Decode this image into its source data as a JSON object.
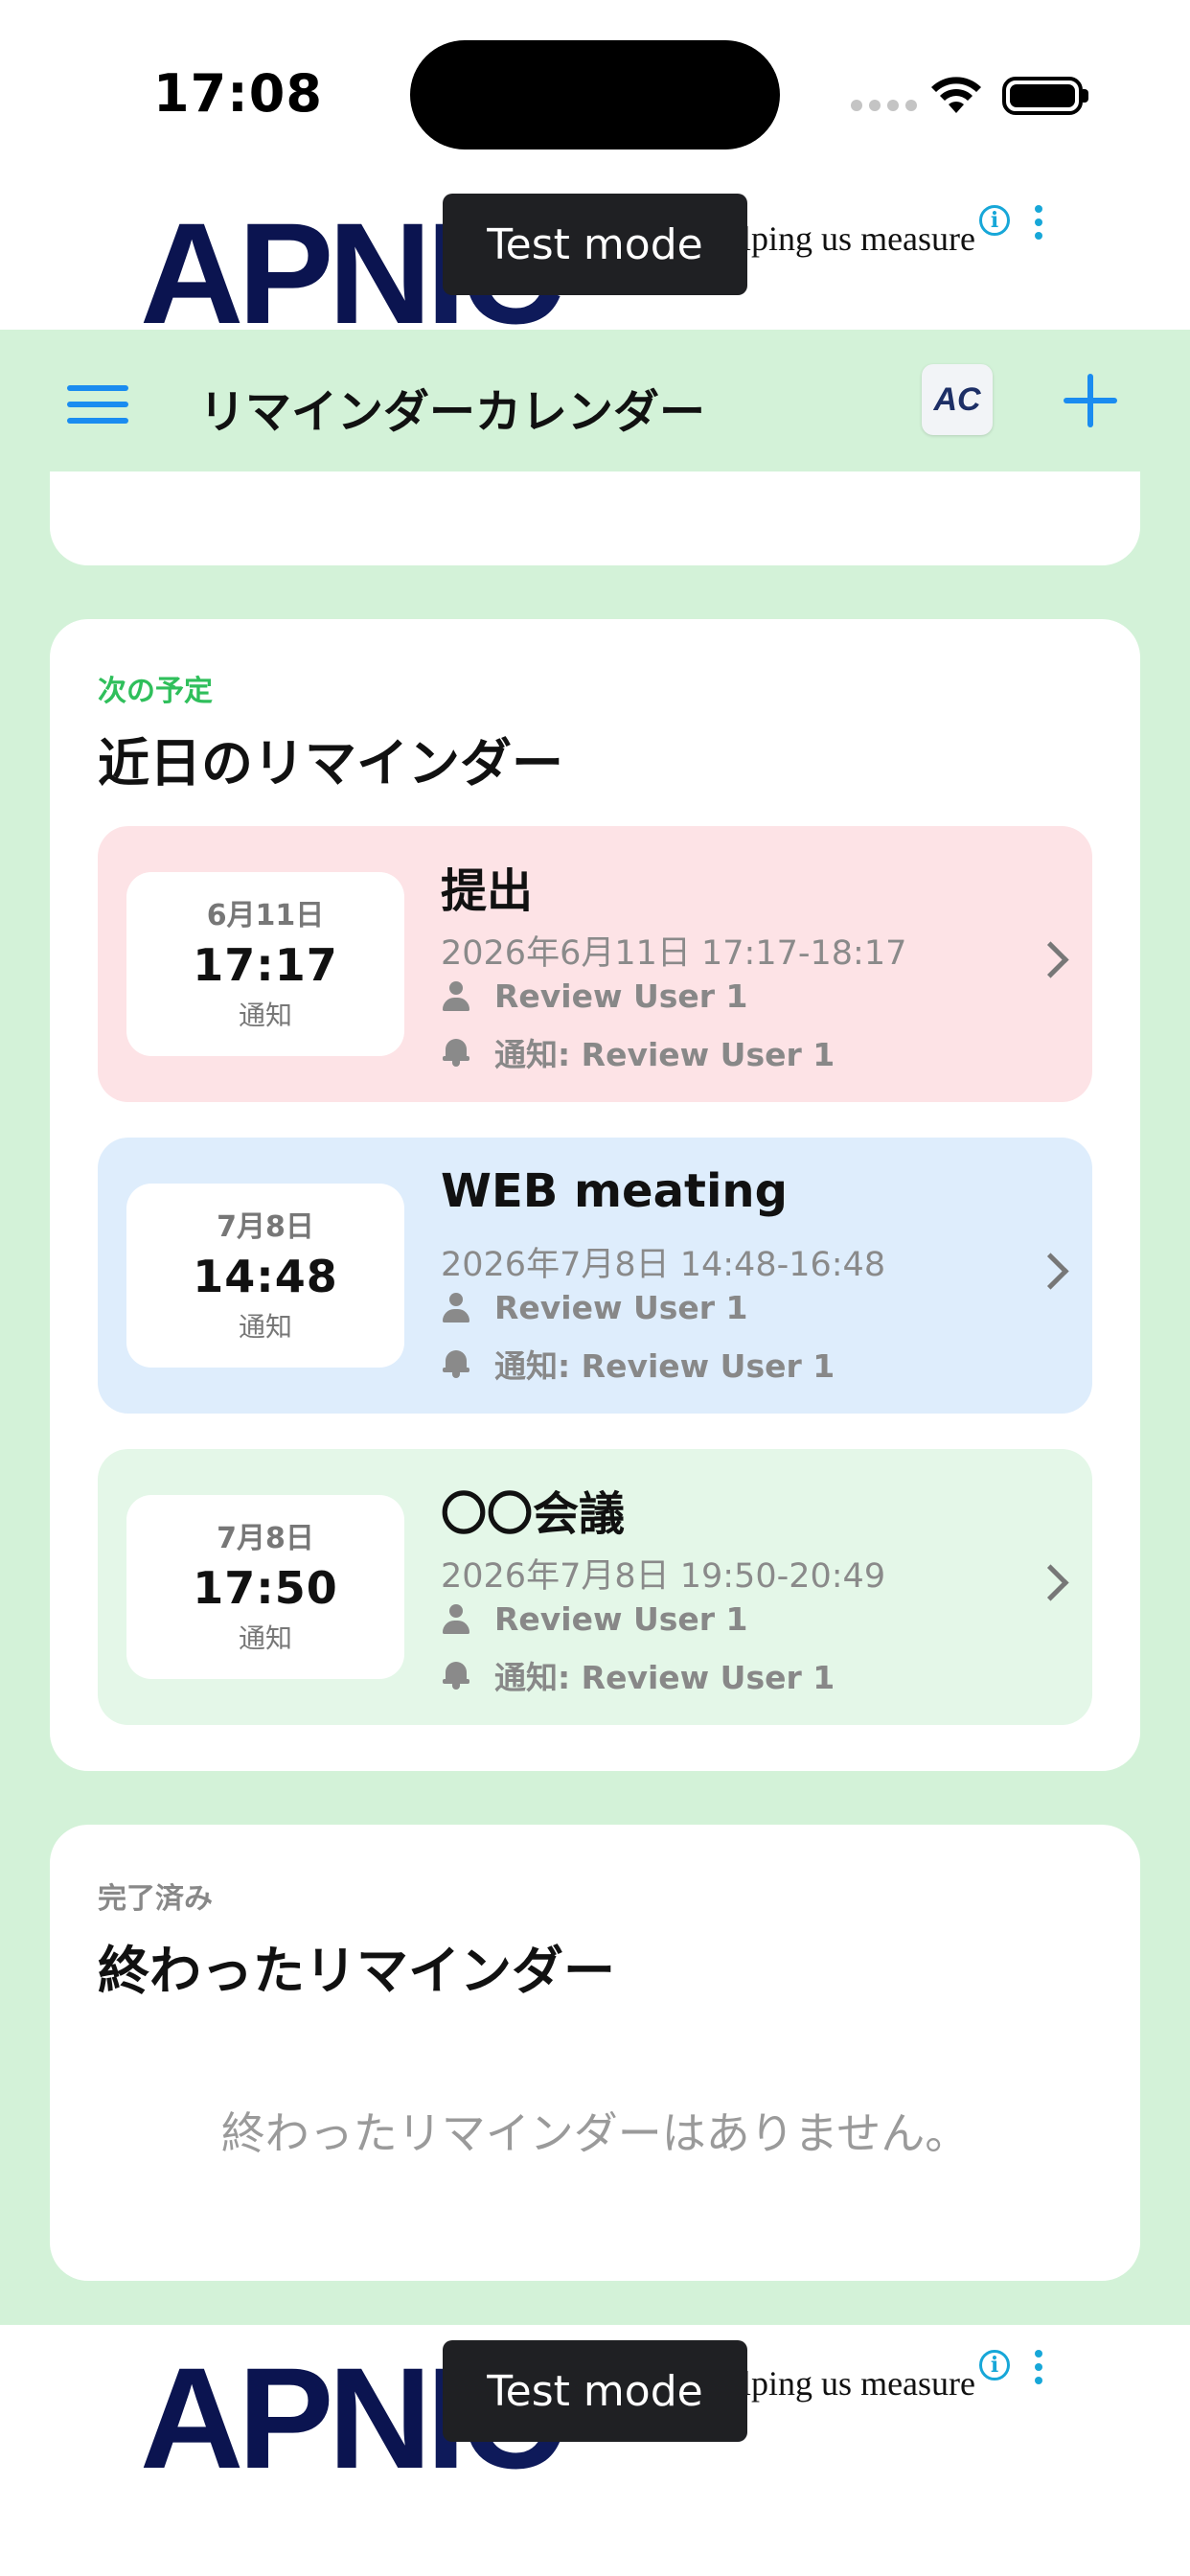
{
  "status_bar": {
    "time": "17:08"
  },
  "ad": {
    "logo_main": "APN",
    "logo_tail": "IC",
    "text": "Thank you for helping us measure",
    "toast": "Test mode"
  },
  "nav": {
    "title": "リマインダーカレンダー",
    "app_icon_text": "AC"
  },
  "upcoming": {
    "eyebrow": "次の予定",
    "title": "近日のリマインダー",
    "items": [
      {
        "date": "6月11日",
        "time": "17:17",
        "note": "通知",
        "title": "提出",
        "range": "2026年6月11日 17:17-18:17",
        "user": "Review User 1",
        "notify": "通知: Review User 1",
        "bg": "#fde3e6"
      },
      {
        "date": "7月8日",
        "time": "14:48",
        "note": "通知",
        "title": "WEB meating",
        "range": "2026年7月8日 14:48-16:48",
        "user": "Review User 1",
        "notify": "通知: Review User 1",
        "bg": "#deedfc"
      },
      {
        "date": "7月8日",
        "time": "17:50",
        "note": "通知",
        "title": "〇〇会議",
        "range": "2026年7月8日 19:50-20:49",
        "user": "Review User 1",
        "notify": "通知: Review User 1",
        "bg": "#e4f7e8"
      }
    ]
  },
  "done": {
    "eyebrow": "完了済み",
    "title": "終わったリマインダー",
    "empty": "終わったリマインダーはありません。"
  },
  "colors": {
    "accent": "#1a8cf0",
    "app_bg": "#d3f2d8",
    "upcoming_eyebrow": "#2fbf5b",
    "done_eyebrow": "#888888"
  }
}
